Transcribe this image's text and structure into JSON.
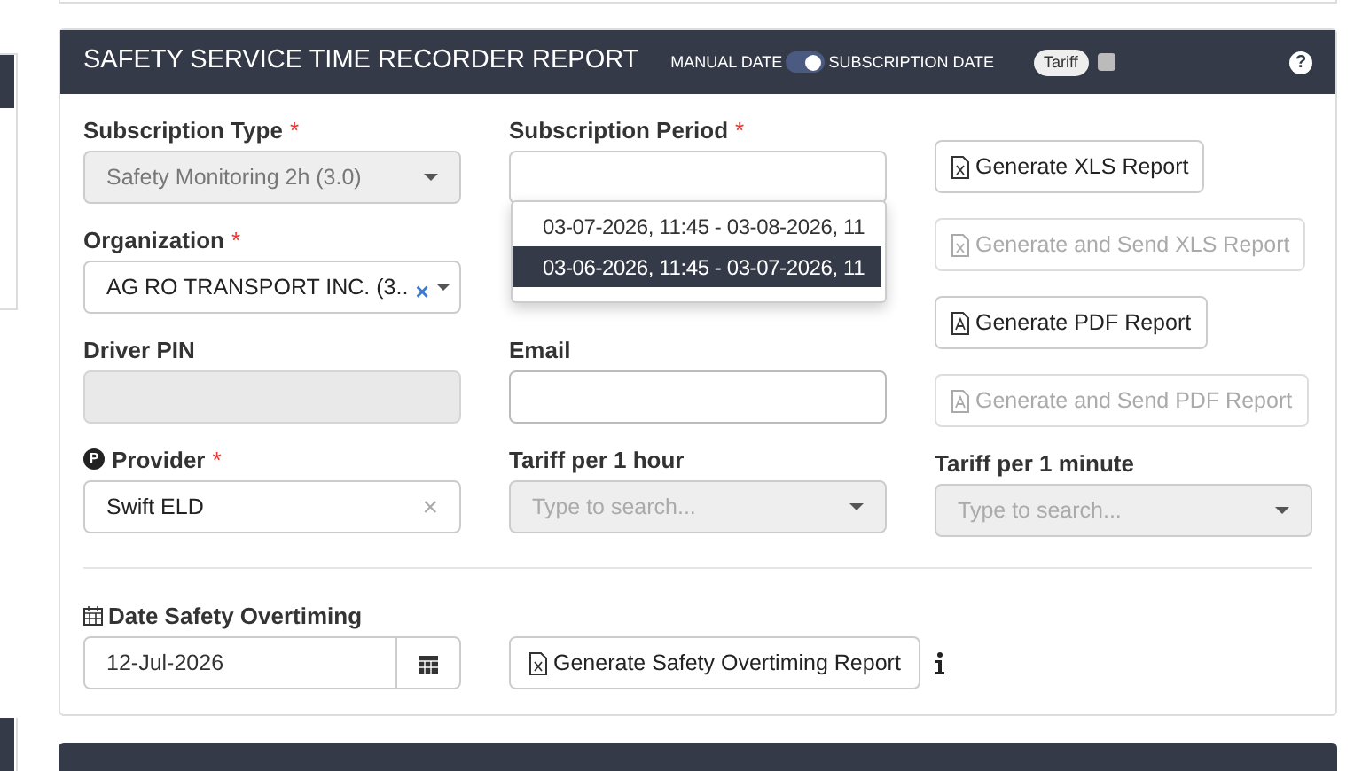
{
  "header": {
    "title": "SAFETY SERVICE TIME RECORDER REPORT",
    "toggle": {
      "left_label": "MANUAL DATE",
      "right_label": "SUBSCRIPTION DATE",
      "on": true
    },
    "tariff": {
      "label": "Tariff",
      "checked": false
    },
    "help": "?"
  },
  "fields": [
    {
      "kind": "select",
      "label": "Subscription Type",
      "mark": "*",
      "value": "Safety Monitoring 2h (3.0)",
      "disabled": true
    },
    {
      "kind": "select",
      "label": "Subscription Period",
      "mark": "*",
      "disabled": false,
      "options": [
        {
          "text": "03-07-2026, 11:45 - 03-08-2026, 11",
          "selected": false
        },
        {
          "text": "03-06-2026, 11:45 - 03-07-2026, 11",
          "selected": true
        }
      ]
    },
    {
      "kind": "select",
      "label": "Organization",
      "mark": "*",
      "value": "AG RO TRANSPORT INC. (3..",
      "disabled": false,
      "clear": "×"
    },
    {
      "kind": "input",
      "label": "Driver PIN",
      "disabled": true
    },
    {
      "kind": "input",
      "label": "Email",
      "disabled": false
    },
    {
      "kind": "clear",
      "label": "Provider",
      "badge": "P",
      "mark": "*",
      "value": "Swift ELD",
      "disabled": false,
      "clear": "×"
    },
    {
      "kind": "select",
      "label": "Tariff per 1 hour",
      "placeholder": "Type to search...",
      "disabled": true
    },
    {
      "kind": "select",
      "label": "Tariff per 1 minute",
      "placeholder": "Type to search...",
      "disabled": true
    }
  ],
  "buttons": [
    {
      "label": "Generate XLS Report",
      "kind": "xls",
      "disabled": false
    },
    {
      "label": "Generate and Send XLS Report",
      "kind": "xls",
      "disabled": true
    },
    {
      "label": "Generate PDF Report",
      "kind": "pdf",
      "disabled": false
    },
    {
      "label": "Generate and Send PDF Report",
      "kind": "pdf",
      "disabled": true
    }
  ],
  "overtiming": {
    "label": "Date Safety Overtiming",
    "date": "12-Jul-2026",
    "button": "Generate Safety Overtiming Report"
  }
}
